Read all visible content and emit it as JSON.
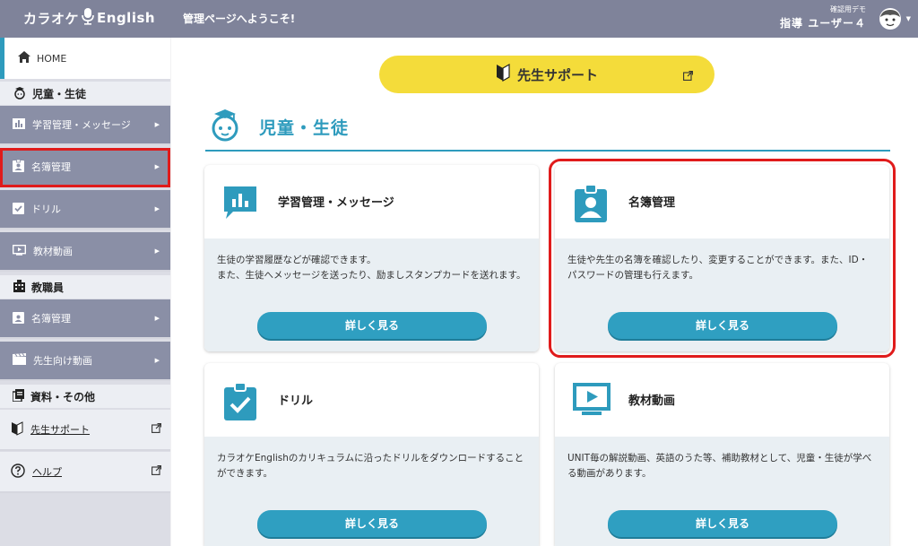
{
  "header": {
    "logo_left": "カラオケ",
    "logo_right": "English",
    "welcome": "管理ページへようこそ!",
    "user_sub": "確認用デモ",
    "user_name": "指導 ユーザー４"
  },
  "sidebar": {
    "home": "HOME",
    "sections": [
      {
        "title": "児童・生徒",
        "items": [
          "学習管理・メッセージ",
          "名簿管理",
          "ドリル",
          "教材動画"
        ]
      },
      {
        "title": "教職員",
        "items": [
          "名簿管理",
          "先生向け動画"
        ]
      },
      {
        "title": "資料・その他",
        "links": [
          "先生サポート",
          "ヘルプ"
        ]
      }
    ]
  },
  "main": {
    "support_label": "先生サポート",
    "section_title": "児童・生徒",
    "cards": [
      {
        "title": "学習管理・メッセージ",
        "desc1": "生徒の学習履歴などが確認できます。",
        "desc2": "また、生徒へメッセージを送ったり、励ましスタンプカードを送れます。",
        "button": "詳しく見る"
      },
      {
        "title": "名簿管理",
        "desc1": "生徒や先生の名簿を確認したり、変更することができます。また、ID・パスワードの管理も行えます。",
        "desc2": "",
        "button": "詳しく見る"
      },
      {
        "title": "ドリル",
        "desc1": "カラオケEnglishのカリキュラムに沿ったドリルをダウンロードすることができます。",
        "desc2": "",
        "button": "詳しく見る"
      },
      {
        "title": "教材動画",
        "desc1": "UNIT毎の解説動画、英語のうた等、補助教材として、児童・生徒が学べる動画があります。",
        "desc2": "",
        "button": "詳しく見る"
      }
    ]
  },
  "colors": {
    "accent": "#2e9bbd",
    "topbar": "#7f839a",
    "support": "#f4dc3a",
    "highlight": "#e01b1b"
  }
}
